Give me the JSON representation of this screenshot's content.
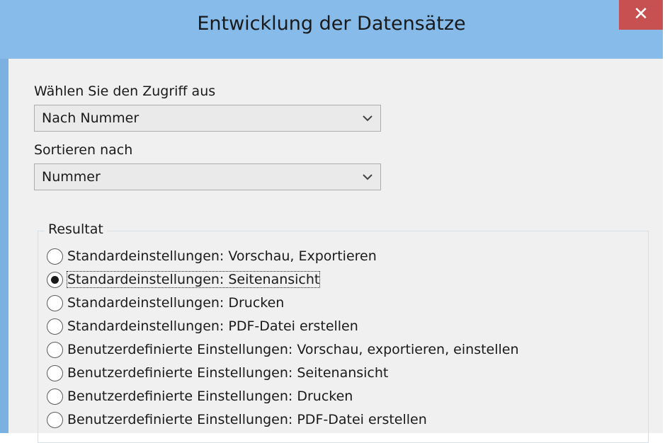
{
  "window": {
    "title": "Entwicklung der Datensätze",
    "close_label": "✕"
  },
  "access": {
    "label": "Wählen Sie den Zugriff aus",
    "value": "Nach Nummer"
  },
  "sort": {
    "label": "Sortieren nach",
    "value": "Nummer"
  },
  "result": {
    "label": "Resultat",
    "options": [
      {
        "label": "Standardeinstellungen: Vorschau, Exportieren",
        "checked": false
      },
      {
        "label": "Standardeinstellungen: Seitenansicht",
        "checked": true
      },
      {
        "label": "Standardeinstellungen: Drucken",
        "checked": false
      },
      {
        "label": "Standardeinstellungen: PDF-Datei erstellen",
        "checked": false
      },
      {
        "label": "Benutzerdefinierte Einstellungen: Vorschau, exportieren, einstellen",
        "checked": false
      },
      {
        "label": "Benutzerdefinierte Einstellungen: Seitenansicht",
        "checked": false
      },
      {
        "label": "Benutzerdefinierte Einstellungen: Drucken",
        "checked": false
      },
      {
        "label": "Benutzerdefinierte Einstellungen: PDF-Datei erstellen",
        "checked": false
      }
    ]
  },
  "icons": {
    "dropdown": "chevron-down-icon",
    "close": "close-icon"
  },
  "colors": {
    "titlebar": "#86bbea",
    "close_button": "#c75050",
    "client_bg": "#f0f0f0"
  }
}
